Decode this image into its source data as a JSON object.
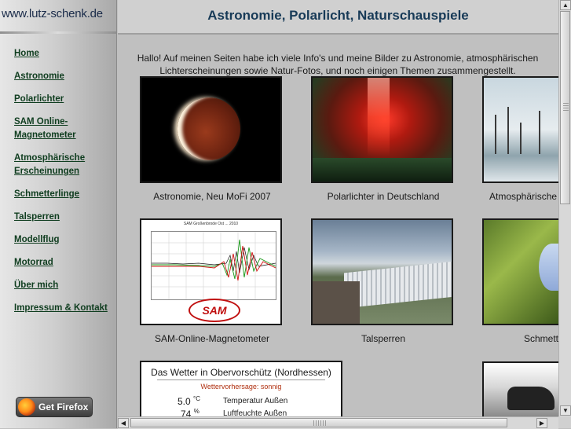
{
  "sidebar": {
    "site_url": "www.lutz-schenk.de",
    "nav": [
      "Home",
      "Astronomie",
      "Polarlichter",
      "SAM Online-Magnetometer",
      "Atmosphärische Erscheinungen",
      "Schmetterlinge",
      "Talsperren",
      "Modellflug",
      "Motorrad",
      "Über mich",
      "Impressum & Kontakt"
    ],
    "firefox_button": "Get Firefox"
  },
  "header": {
    "title": "Astronomie, Polarlicht, Naturschauspiele"
  },
  "intro": "Hallo! Auf meinen Seiten habe ich viele Info's und meine Bilder zu Astronomie, atmosphärischen Lichterscheinungen sowie Natur-Fotos, und noch einigen Themen zusammengestellt.",
  "gallery": {
    "captions": [
      "Astronomie, Neu MoFi 2007",
      "Polarlichter in Deutschland",
      "Atmosphärische",
      "SAM-Online-Magnetometer",
      "Talsperren",
      "Schmett"
    ],
    "icons": [
      "lunar-eclipse-photo",
      "aurora-photo",
      "winter-trees-photo",
      "magnetometer-chart",
      "dam-photo",
      "butterfly-photo",
      "motorcycle-photo"
    ]
  },
  "weather": {
    "title": "Das Wetter in Obervorschütz (Nordhessen)",
    "forecast": "Wettervorhersage: sonnig",
    "rows": [
      {
        "value": "5.0",
        "unit": "°C",
        "label": "Temperatur Außen"
      },
      {
        "value": "74",
        "unit": "%",
        "label": "Luftfeuchte Außen"
      }
    ]
  },
  "sam_chart": {
    "title": "SAM Großenbrode Ost ... 2010"
  },
  "scrollbars": {
    "up_arrow": "▲",
    "down_arrow": "▼",
    "left_arrow": "◀",
    "right_arrow": "▶"
  },
  "colors": {
    "nav_link": "#0f3d1f",
    "title": "#173a57",
    "forecast": "#b03010"
  }
}
